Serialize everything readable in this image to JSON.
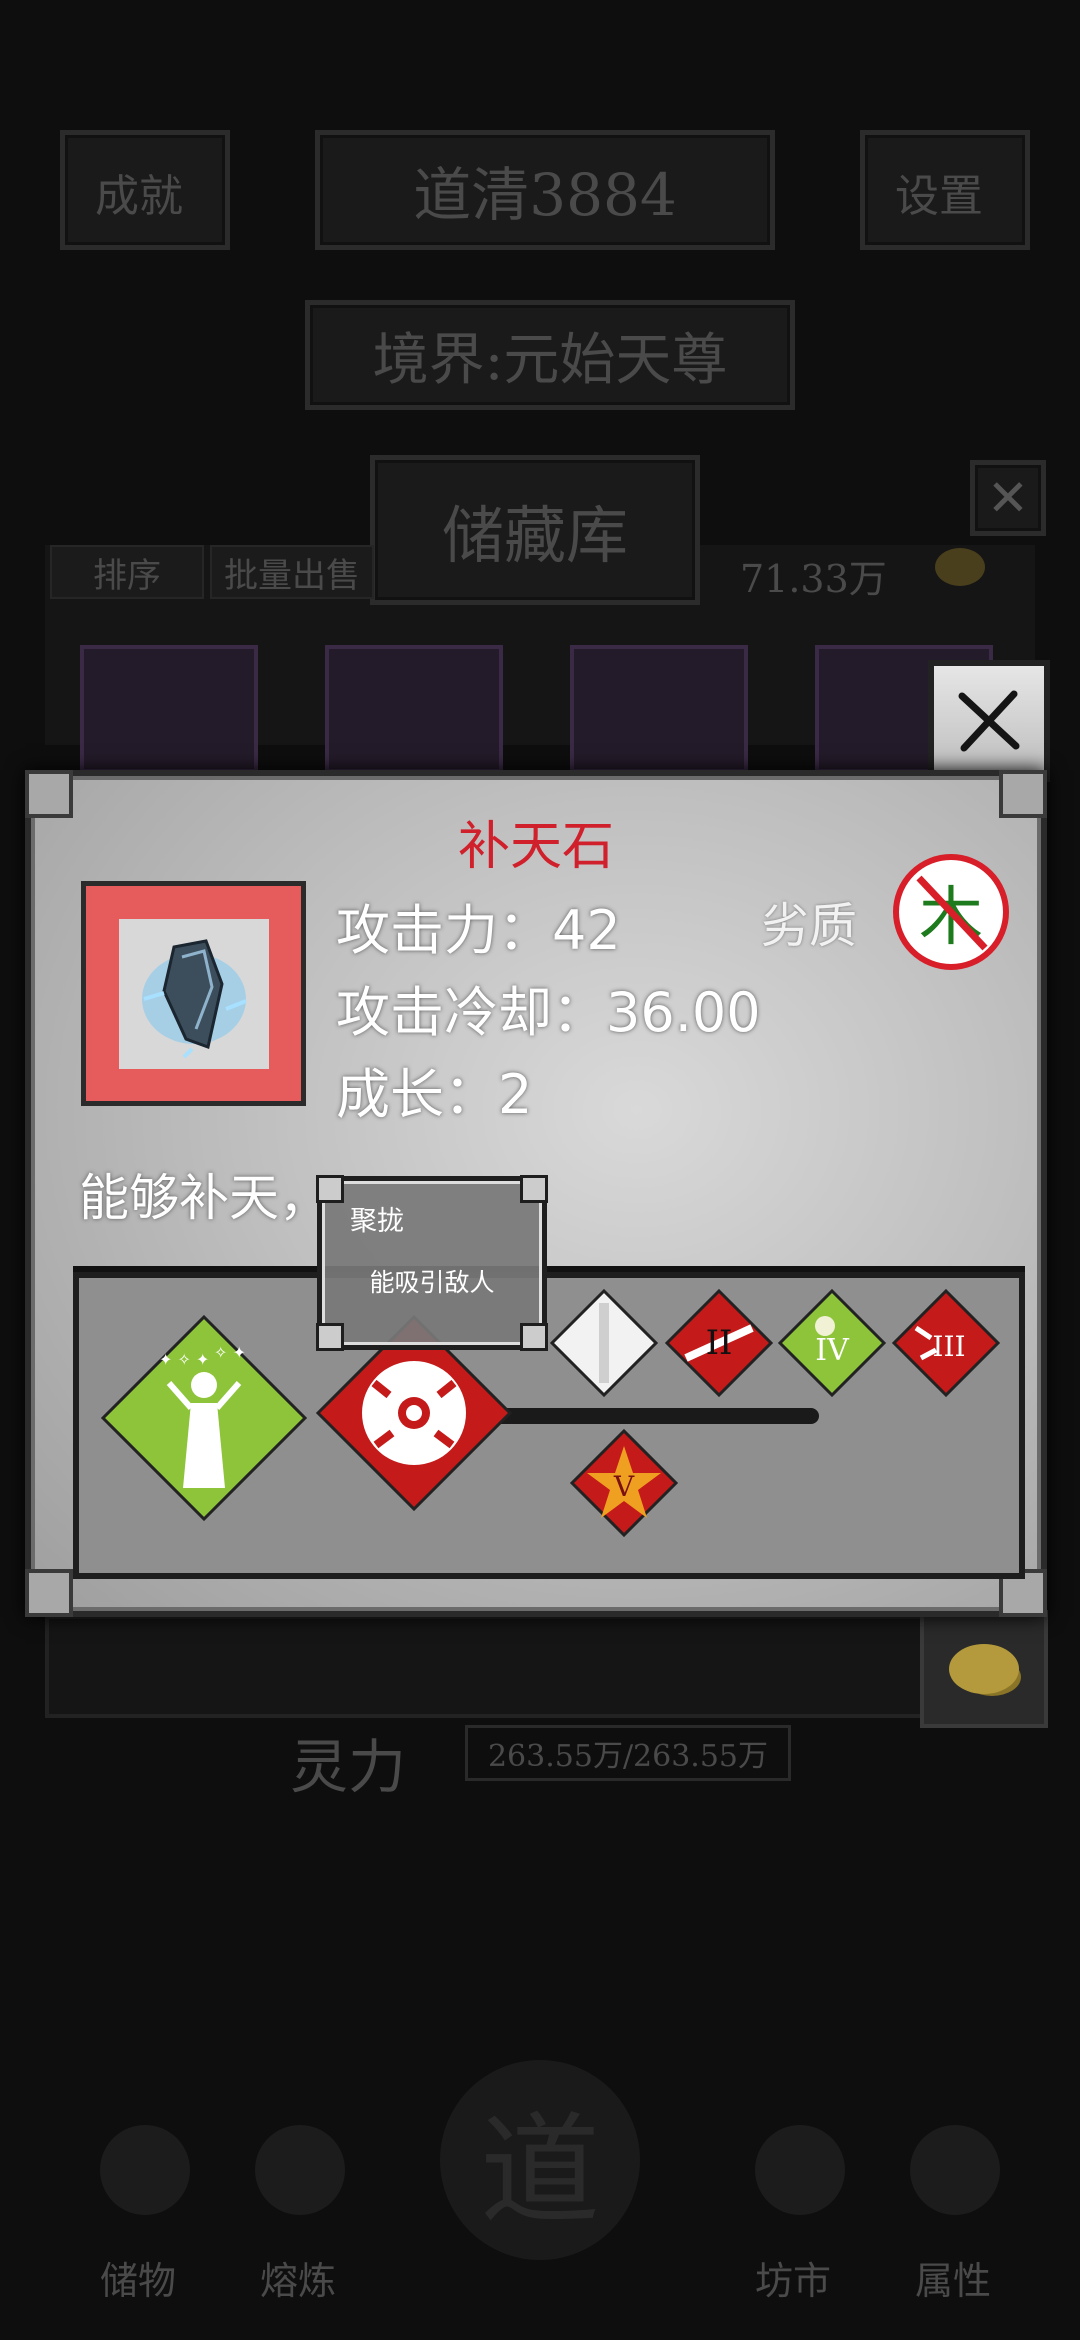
{
  "background": {
    "top_left_button": "成就",
    "dao_value": "道清3884",
    "top_right_button": "设置",
    "realm": "境界:元始天尊",
    "storage": {
      "title": "储藏库",
      "sort_label": "排序",
      "batch_sell_label": "批量出售",
      "money": "71.33万"
    },
    "lingli_label": "灵力",
    "lingli_value": "263.55万/263.55万",
    "nav": [
      "储物",
      "熔炼",
      "坊市",
      "属性"
    ],
    "nav_center": "道"
  },
  "item": {
    "name": "补天石",
    "attack_label": "攻击力：42",
    "cooldown_label": "攻击冷却：36.00",
    "growth_label": "成长：2",
    "quality": "劣质",
    "element": "木",
    "description": "能够补天，"
  },
  "skills": [
    {
      "icon": "summon-icon",
      "color": "#8dc43a"
    },
    {
      "icon": "ball-icon",
      "color": "#c41a1a"
    },
    {
      "icon": "white-blade-icon",
      "color": "#f2f2f2"
    },
    {
      "icon": "rank-ii-icon",
      "numeral": "II",
      "color": "#c41a1a"
    },
    {
      "icon": "rank-iv-icon",
      "numeral": "IV",
      "color": "#8dc43a"
    },
    {
      "icon": "rank-iii-icon",
      "numeral": "III",
      "color": "#c41a1a"
    },
    {
      "icon": "rank-v-icon",
      "numeral": "V",
      "color": "#c41a1a"
    }
  ],
  "tooltip": {
    "title": "聚拢",
    "description": "能吸引敌人"
  },
  "colors": {
    "item_name": "#d0202c",
    "element_green": "#1d7a1d",
    "forbidden_red": "#d81e28"
  }
}
